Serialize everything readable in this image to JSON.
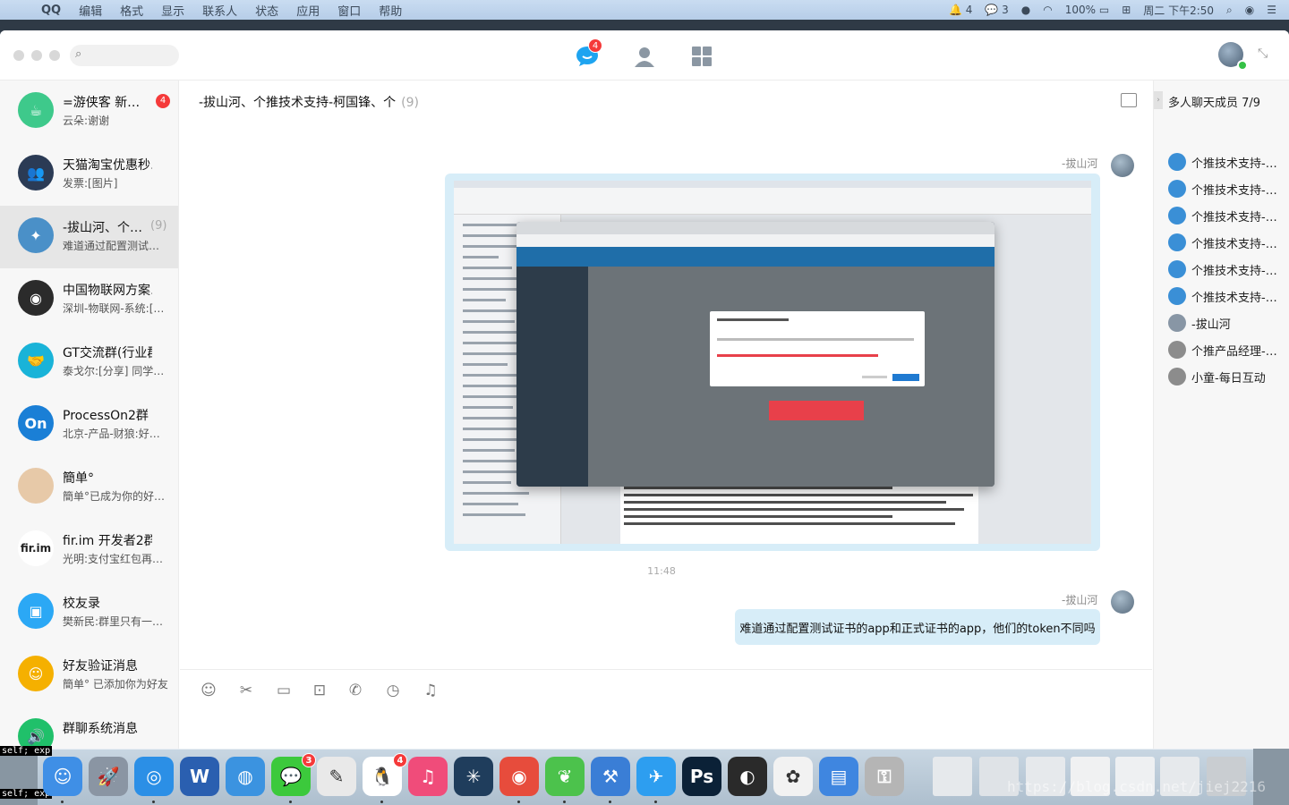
{
  "menubar": {
    "app": "QQ",
    "items": [
      "编辑",
      "格式",
      "显示",
      "联系人",
      "状态",
      "应用",
      "窗口",
      "帮助"
    ],
    "status": {
      "notif_count": "4",
      "wechat_count": "3",
      "battery": "100%",
      "datetime": "周二 下午2:50"
    }
  },
  "toolbar": {
    "search_placeholder": "",
    "messages_badge": "4"
  },
  "conversations": [
    {
      "name": "=游侠客 新…",
      "msg": "云朵:谢谢",
      "badge": "4",
      "count": "",
      "color": "#3ec98b",
      "glyph": "☕"
    },
    {
      "name": "天猫淘宝优惠秒…",
      "msg": "发票:[图片]",
      "badge": "",
      "count": "",
      "color": "#2b3b55",
      "glyph": "👥"
    },
    {
      "name": "-拔山河、个…",
      "msg": "难道通过配置测试…",
      "badge": "",
      "count": "(9)",
      "color": "#4a90c8",
      "glyph": "✦"
    },
    {
      "name": "中国物联网方案…",
      "msg": "深圳-物联网-系统:[…",
      "badge": "",
      "count": "",
      "color": "#2b2b2b",
      "glyph": "◉"
    },
    {
      "name": "GT交流群(行业群)",
      "msg": "泰戈尔:[分享] 同学…",
      "badge": "",
      "count": "",
      "color": "#19b3d8",
      "glyph": "🤝"
    },
    {
      "name": "ProcessOn2群",
      "msg": "北京-产品-财狼:好…",
      "badge": "",
      "count": "",
      "color": "#1a7fd6",
      "glyph": "On"
    },
    {
      "name": "簡单°",
      "msg": "簡单°已成为你的好…",
      "badge": "",
      "count": "",
      "color": "#e7c9a8",
      "glyph": ""
    },
    {
      "name": "fir.im  开发者2群",
      "msg": "光明:支付宝红包再…",
      "badge": "",
      "count": "",
      "color": "#ffffff",
      "glyph": "fir.im"
    },
    {
      "name": "校友录",
      "msg": "樊新民:群里只有一…",
      "badge": "",
      "count": "",
      "color": "#2ba8f5",
      "glyph": "▣"
    },
    {
      "name": "好友验证消息",
      "msg": "簡单° 已添加你为好友",
      "badge": "",
      "count": "",
      "color": "#f5b000",
      "glyph": "☺"
    },
    {
      "name": "群聊系统消息",
      "msg": "",
      "badge": "",
      "count": "",
      "color": "#20c06a",
      "glyph": "🔊"
    }
  ],
  "chat": {
    "title": "-拔山河、个推技术支持-柯国锋、个",
    "count": "(9)",
    "messages": [
      {
        "sender": "-拔山河",
        "type": "image"
      },
      {
        "timestamp": "11:48"
      },
      {
        "sender": "-拔山河",
        "type": "text",
        "text": "难道通过配置测试证书的app和正式证书的app，他们的token不同吗"
      }
    ]
  },
  "members": {
    "header": "多人聊天成员 7/9",
    "items": [
      {
        "name": "个推技术支持-…",
        "color": "#3a8fd6"
      },
      {
        "name": "个推技术支持-…",
        "color": "#3a8fd6"
      },
      {
        "name": "个推技术支持-…",
        "color": "#3a8fd6"
      },
      {
        "name": "个推技术支持-…",
        "color": "#3a8fd6"
      },
      {
        "name": "个推技术支持-…",
        "color": "#3a8fd6"
      },
      {
        "name": "个推技术支持-…",
        "color": "#3a8fd6"
      },
      {
        "name": "-拔山河",
        "color": "#8896a5"
      },
      {
        "name": "个推产品经理-…",
        "color": "#8c8c8c"
      },
      {
        "name": "小童-每日互动",
        "color": "#8c8c8c"
      }
    ]
  },
  "dock": {
    "apps": [
      {
        "name": "finder-icon",
        "color": "#3f8fe6",
        "glyph": "☺",
        "badge": ""
      },
      {
        "name": "launchpad-icon",
        "color": "#8a95a3",
        "glyph": "🚀",
        "badge": ""
      },
      {
        "name": "safari-icon",
        "color": "#2b8fe6",
        "glyph": "◎",
        "badge": ""
      },
      {
        "name": "word-icon",
        "color": "#2a5fb0",
        "glyph": "W",
        "badge": ""
      },
      {
        "name": "chef-icon",
        "color": "#3b93e0",
        "glyph": "◍",
        "badge": ""
      },
      {
        "name": "wechat-icon",
        "color": "#3cc93c",
        "glyph": "💬",
        "badge": "3"
      },
      {
        "name": "textedit-icon",
        "color": "#e9e9e9",
        "glyph": "✎",
        "badge": ""
      },
      {
        "name": "qq-icon",
        "color": "#ffffff",
        "glyph": "🐧",
        "badge": "4"
      },
      {
        "name": "itunes-icon",
        "color": "#f04c7a",
        "glyph": "♫",
        "badge": ""
      },
      {
        "name": "sourcetree-icon",
        "color": "#1f3d5c",
        "glyph": "✳",
        "badge": ""
      },
      {
        "name": "chrome-icon",
        "color": "#e74c3c",
        "glyph": "◉",
        "badge": ""
      },
      {
        "name": "leaf-icon",
        "color": "#4cc24c",
        "glyph": "❦",
        "badge": ""
      },
      {
        "name": "xcode-icon",
        "color": "#3a7ed6",
        "glyph": "⚒",
        "badge": ""
      },
      {
        "name": "airmail-icon",
        "color": "#2d9ef0",
        "glyph": "✈",
        "badge": ""
      },
      {
        "name": "photoshop-icon",
        "color": "#0b2137",
        "glyph": "Ps",
        "badge": ""
      },
      {
        "name": "dvd-icon",
        "color": "#2a2a2a",
        "glyph": "◐",
        "badge": ""
      },
      {
        "name": "photos-icon",
        "color": "#f2f2f2",
        "glyph": "✿",
        "badge": ""
      },
      {
        "name": "simulator-icon",
        "color": "#3f86e0",
        "glyph": "▤",
        "badge": ""
      },
      {
        "name": "keychain-icon",
        "color": "#b5b5b5",
        "glyph": "⚿",
        "badge": ""
      }
    ],
    "watermark": "https://blog.csdn.net/jiej2216",
    "term_fragment": "self; exp"
  }
}
